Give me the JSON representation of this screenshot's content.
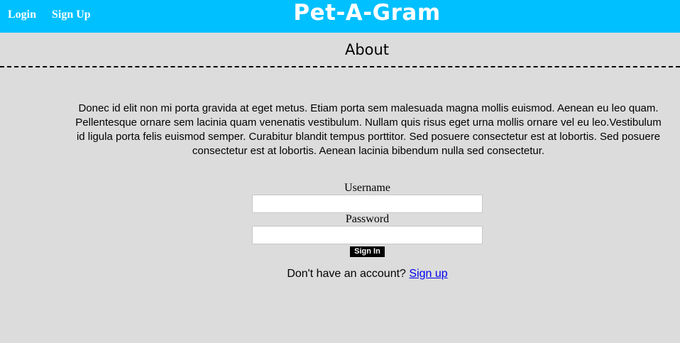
{
  "header": {
    "login_label": "Login",
    "signup_label": "Sign Up",
    "brand_title": "Pet-A-Gram",
    "background_color": "#00c0ff"
  },
  "about": {
    "title": "About",
    "body": "Donec id elit non mi porta gravida at eget metus. Etiam porta sem malesuada magna mollis euismod. Aenean eu leo quam. Pellentesque ornare sem lacinia quam venenatis vestibulum. Nullam quis risus eget urna mollis ornare vel eu leo.Vestibulum id ligula porta felis euismod semper. Curabitur blandit tempus porttitor. Sed posuere consectetur est at lobortis. Sed posuere consectetur est at lobortis. Aenean lacinia bibendum nulla sed consectetur."
  },
  "login_form": {
    "username_label": "Username",
    "username_value": "",
    "password_label": "Password",
    "password_value": "",
    "submit_label": "Sign In",
    "no_account_text": "Don't have an account?",
    "signup_link_label": "Sign up"
  },
  "colors": {
    "page_background": "#dcdcdc",
    "link": "#0000ee",
    "button": "#000000"
  }
}
